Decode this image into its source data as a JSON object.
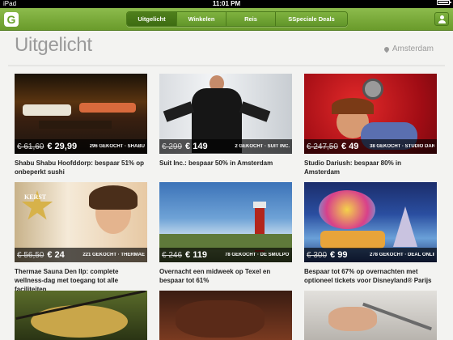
{
  "status": {
    "device": "iPad",
    "time": "11:01 PM"
  },
  "nav": {
    "logo": "G",
    "tabs": [
      {
        "label": "Uitgelicht",
        "active": true
      },
      {
        "label": "Winkelen",
        "active": false
      },
      {
        "label": "Reis",
        "active": false
      },
      {
        "label": "SSpeciale Deals",
        "active": false
      }
    ],
    "profile_icon": "person-icon"
  },
  "header": {
    "title": "Uitgelicht",
    "location": "Amsterdam"
  },
  "deals": [
    {
      "old_price": "€ 61,60",
      "new_price": "€ 29,99",
      "meta": "296 GEKOCHT · SHABU",
      "title": "Shabu Shabu Hoofddorp: bespaar 51% op onbeperkt sushi"
    },
    {
      "old_price": "€ 299",
      "new_price": "€ 149",
      "meta": "2 GEKOCHT · SUIT INC.",
      "title": "Suit Inc.: bespaar 50% in Amsterdam"
    },
    {
      "old_price": "€ 247,50",
      "new_price": "€ 49",
      "meta": "38 GEKOCHT · STUDIO DAR",
      "title": "Studio Dariush: bespaar 80% in Amsterdam"
    },
    {
      "old_price": "€ 56,50",
      "new_price": "€ 24",
      "meta": "221 GEKOCHT · THERMAE",
      "title": "Thermae Sauna Den Ilp: complete wellness-dag met toegang tot alle faciliteiten",
      "badge": "KERST"
    },
    {
      "old_price": "€ 246",
      "new_price": "€ 119",
      "meta": "78 GEKOCHT · DE SMULPOT",
      "title": "Overnacht een midweek op Texel en bespaar tot 61%"
    },
    {
      "old_price": "€ 300",
      "new_price": "€ 99",
      "meta": "278 GEKOCHT · DEAL ONLINE",
      "title": "Bespaar tot 67% op overnachten met optioneel tickets voor Disneyland® Parijs"
    }
  ]
}
